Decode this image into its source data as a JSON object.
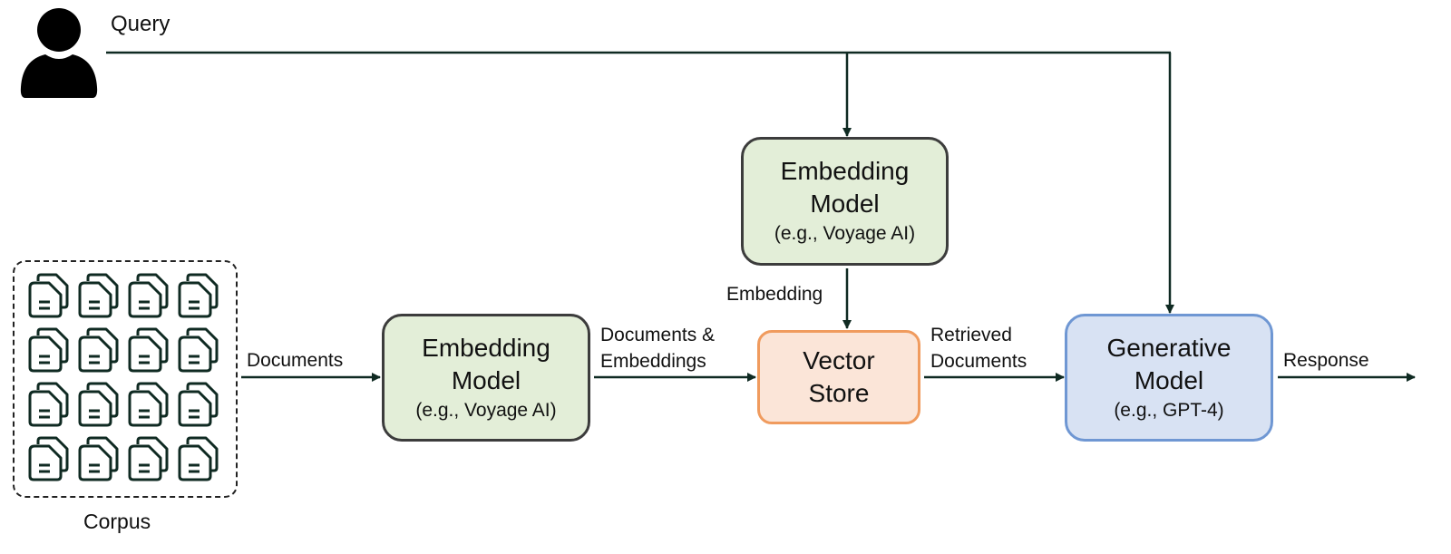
{
  "query": {
    "label": "Query",
    "icon": "user-icon"
  },
  "corpus": {
    "label": "Corpus",
    "icon": "document-stack-icon",
    "document_icon_count": 16
  },
  "nodes": {
    "embedding_top": {
      "title_line1": "Embedding",
      "title_line2": "Model",
      "subtitle": "(e.g., Voyage AI)"
    },
    "embedding_main": {
      "title_line1": "Embedding",
      "title_line2": "Model",
      "subtitle": "(e.g., Voyage AI)"
    },
    "vector_store": {
      "title_line1": "Vector",
      "title_line2": "Store"
    },
    "generative": {
      "title_line1": "Generative",
      "title_line2": "Model",
      "subtitle": "(e.g., GPT-4)"
    }
  },
  "edges": {
    "documents": "Documents",
    "docs_embeddings_line1": "Documents &",
    "docs_embeddings_line2": "Embeddings",
    "embedding": "Embedding",
    "retrieved_line1": "Retrieved",
    "retrieved_line2": "Documents",
    "response": "Response"
  },
  "colors": {
    "line": "#0f2a22",
    "embedding_fill": "#e3eed8",
    "vector_fill": "#fbe5d8",
    "vector_border": "#f09b5e",
    "generative_fill": "#d8e2f3",
    "generative_border": "#6f97d3"
  }
}
